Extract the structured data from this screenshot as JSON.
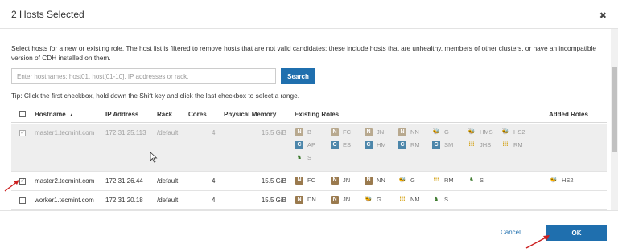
{
  "dialog": {
    "title": "2 Hosts Selected",
    "close_icon": "close-icon"
  },
  "description": "Select hosts for a new or existing role. The host list is filtered to remove hosts that are not valid candidates; these include hosts that are unhealthy, members of other clusters, or have an incompatible version of CDH installed on them.",
  "search": {
    "placeholder": "Enter hostnames: host01, host[01-10], IP addresses or rack.",
    "button_label": "Search"
  },
  "tip": "Tip: Click the first checkbox, hold down the Shift key and click the last checkbox to select a range.",
  "table": {
    "headers": {
      "hostname": "Hostname",
      "ip": "IP Address",
      "rack": "Rack",
      "cores": "Cores",
      "memory": "Physical Memory",
      "existing_roles": "Existing Roles",
      "added_roles": "Added Roles"
    },
    "sort_indicator": "▲",
    "rows": [
      {
        "hostname": "master1.tecmint.com",
        "ip": "172.31.25.113",
        "rack": "/default",
        "cores": "4",
        "memory": "15.5 GiB",
        "checked": true,
        "disabled": true,
        "roles": [
          {
            "icon": "hdfs",
            "label": "B"
          },
          {
            "icon": "hdfs",
            "label": "FC"
          },
          {
            "icon": "hdfs",
            "label": "JN"
          },
          {
            "icon": "hdfs",
            "label": "NN"
          },
          {
            "icon": "hive",
            "label": "G"
          },
          {
            "icon": "hive",
            "label": "HMS"
          },
          {
            "icon": "hive",
            "label": "HS2"
          },
          {
            "icon": "hbase",
            "label": "AP"
          },
          {
            "icon": "hbase",
            "label": "ES"
          },
          {
            "icon": "hbase",
            "label": "HM"
          },
          {
            "icon": "hbase",
            "label": "RM"
          },
          {
            "icon": "hbase",
            "label": "SM"
          },
          {
            "icon": "yarn",
            "label": "JHS"
          },
          {
            "icon": "yarn",
            "label": "RM"
          },
          {
            "icon": "zk",
            "label": "S"
          }
        ],
        "added_roles": []
      },
      {
        "hostname": "master2.tecmint.com",
        "ip": "172.31.26.44",
        "rack": "/default",
        "cores": "4",
        "memory": "15.5 GiB",
        "checked": true,
        "disabled": false,
        "roles": [
          {
            "icon": "hdfs",
            "label": "FC"
          },
          {
            "icon": "hdfs",
            "label": "JN"
          },
          {
            "icon": "hdfs",
            "label": "NN"
          },
          {
            "icon": "hive",
            "label": "G"
          },
          {
            "icon": "yarn",
            "label": "RM"
          },
          {
            "icon": "zk",
            "label": "S"
          }
        ],
        "added_roles": [
          {
            "icon": "hive",
            "label": "HS2"
          }
        ]
      },
      {
        "hostname": "worker1.tecmint.com",
        "ip": "172.31.20.18",
        "rack": "/default",
        "cores": "4",
        "memory": "15.5 GiB",
        "checked": false,
        "disabled": false,
        "roles": [
          {
            "icon": "hdfs",
            "label": "DN"
          },
          {
            "icon": "hdfs",
            "label": "JN"
          },
          {
            "icon": "hive",
            "label": "G"
          },
          {
            "icon": "yarn",
            "label": "NM"
          },
          {
            "icon": "zk",
            "label": "S"
          }
        ],
        "added_roles": []
      }
    ]
  },
  "footer": {
    "cancel_label": "Cancel",
    "ok_label": "OK"
  },
  "colors": {
    "primary": "#1f6fae",
    "annotation_arrow": "#cc1f1f",
    "disabled_row": "#eeeeee"
  }
}
